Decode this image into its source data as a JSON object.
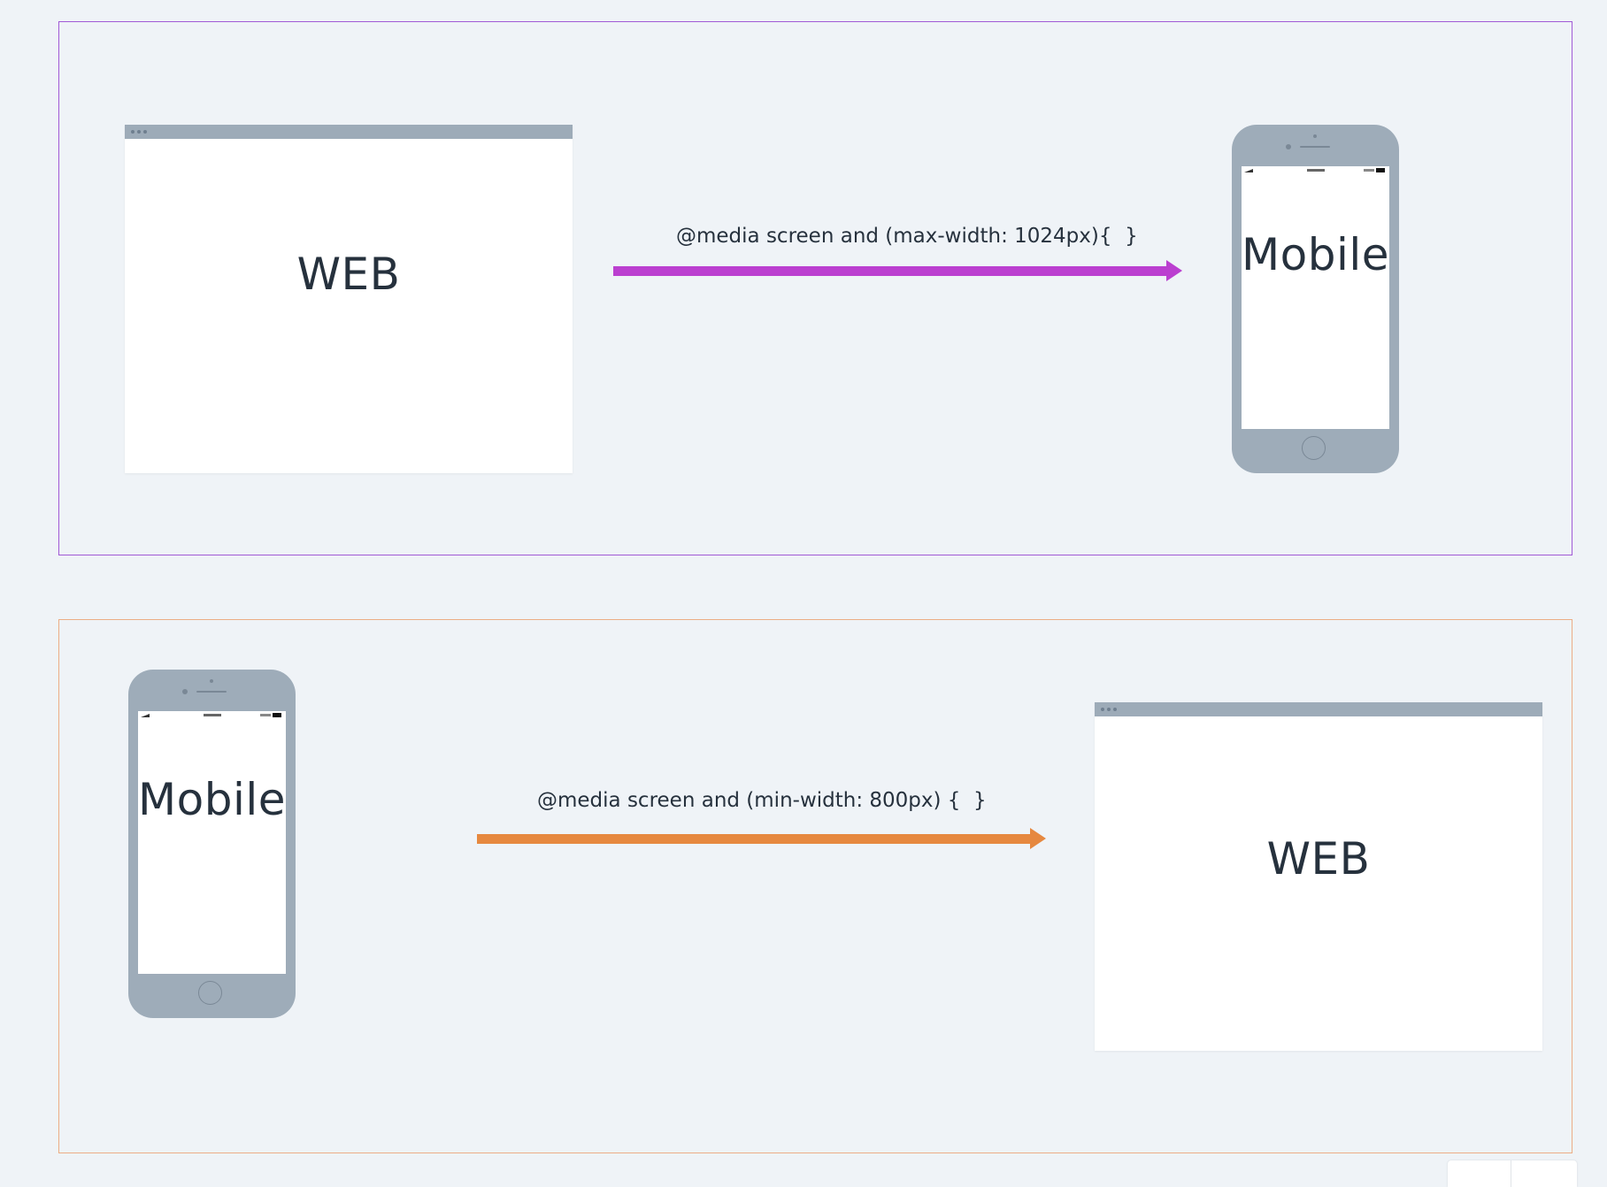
{
  "diagrams": [
    {
      "border_color": "#a15ad6",
      "source_device": {
        "type": "browser",
        "label": "WEB"
      },
      "arrow": {
        "color": "#bb3fd0",
        "label": "@media screen and (max-width: 1024px){  }"
      },
      "target_device": {
        "type": "phone",
        "label": "Mobile"
      }
    },
    {
      "border_color": "#ecad85",
      "source_device": {
        "type": "phone",
        "label": "Mobile"
      },
      "arrow": {
        "color": "#e6883f",
        "label": "@media screen and (min-width: 800px) {  }"
      },
      "target_device": {
        "type": "browser",
        "label": "WEB"
      }
    }
  ],
  "colors": {
    "background": "#eff3f7",
    "device_frame": "#9eacb9",
    "text": "#26313d"
  }
}
